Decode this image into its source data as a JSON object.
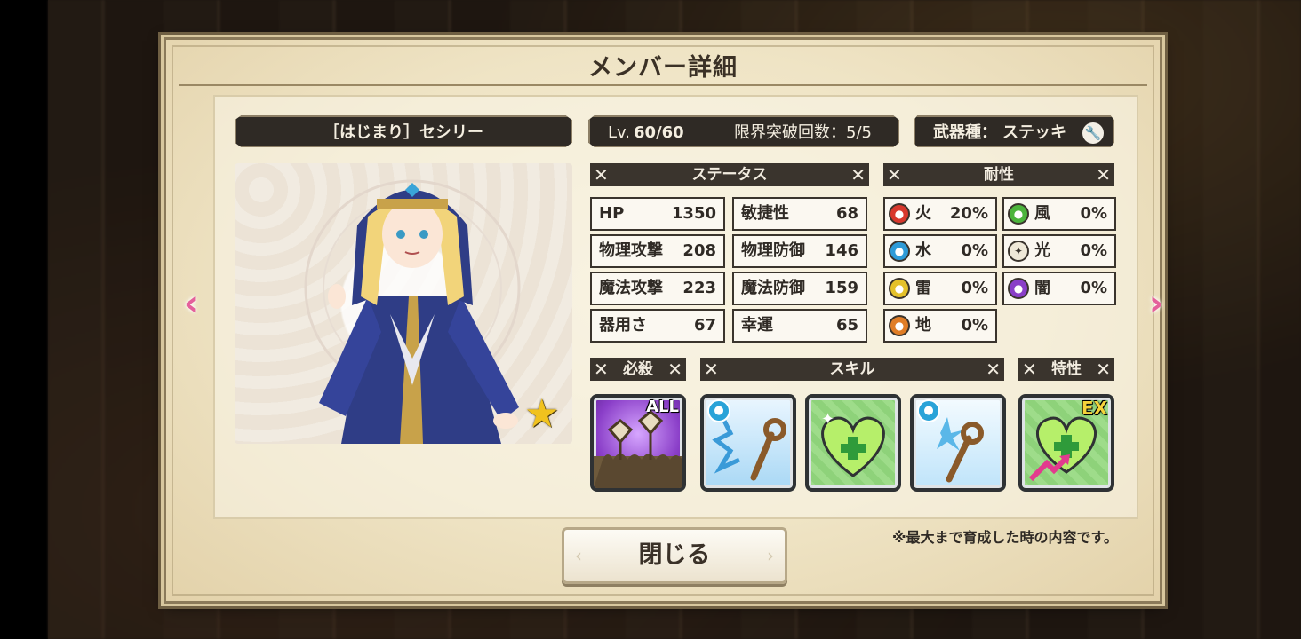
{
  "window": {
    "title": "メンバー詳細"
  },
  "character": {
    "name": "［はじまり］セシリー",
    "rarity_icon": "star-icon"
  },
  "level": {
    "label": "Lv.",
    "value": "60/60",
    "limit_label": "限界突破回数：",
    "limit_value": "5/5"
  },
  "weapon": {
    "label": "武器種：",
    "value": "ステッキ",
    "icon": "wrench-icon"
  },
  "status": {
    "header": "ステータス",
    "stats": [
      {
        "label": "HP",
        "value": "1350"
      },
      {
        "label": "敏捷性",
        "value": "68"
      },
      {
        "label": "物理攻撃",
        "value": "208"
      },
      {
        "label": "物理防御",
        "value": "146"
      },
      {
        "label": "魔法攻撃",
        "value": "223"
      },
      {
        "label": "魔法防御",
        "value": "159"
      },
      {
        "label": "器用さ",
        "value": "67"
      },
      {
        "label": "幸運",
        "value": "65"
      }
    ]
  },
  "resistance": {
    "header": "耐性",
    "items": [
      {
        "label": "火",
        "value": "20%",
        "icon": "fire-icon",
        "color": "#d8382d"
      },
      {
        "label": "風",
        "value": "0%",
        "icon": "wind-icon",
        "color": "#4cb43c"
      },
      {
        "label": "水",
        "value": "0%",
        "icon": "water-icon",
        "color": "#2e9bd8"
      },
      {
        "label": "光",
        "value": "0%",
        "icon": "light-icon",
        "color": "#efe9d8"
      },
      {
        "label": "雷",
        "value": "0%",
        "icon": "thunder-icon",
        "color": "#e4c12a"
      },
      {
        "label": "闇",
        "value": "0%",
        "icon": "dark-icon",
        "color": "#8a3ec8"
      },
      {
        "label": "地",
        "value": "0%",
        "icon": "earth-icon",
        "color": "#e07d26"
      }
    ]
  },
  "sections": {
    "special": "必殺",
    "skills": "スキル",
    "traits": "特性"
  },
  "skill_icons": [
    {
      "name": "special-skill-icon",
      "badge": "ALL"
    },
    {
      "name": "skill-wind-staff-icon",
      "badge": ""
    },
    {
      "name": "skill-heal-heart-icon",
      "badge": ""
    },
    {
      "name": "skill-sparkle-staff-icon",
      "badge": ""
    },
    {
      "name": "trait-heal-up-icon",
      "badge": "EX"
    }
  ],
  "note": "※最大まで育成した時の内容です。",
  "close_button": "閉じる"
}
